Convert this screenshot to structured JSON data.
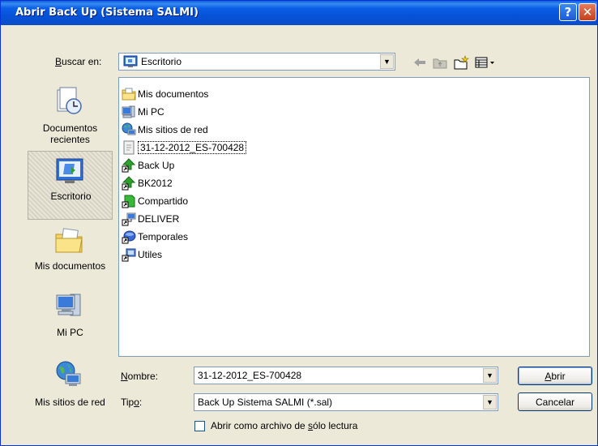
{
  "window": {
    "title": "Abrir Back Up (Sistema SALMI)",
    "help_glyph": "?",
    "close_glyph": "✕"
  },
  "lookin": {
    "label_pre": "B",
    "label_post": "uscar en:",
    "value": "Escritorio"
  },
  "places": [
    {
      "label": "Documentos recientes",
      "icon": "recent-documents-icon"
    },
    {
      "label": "Escritorio",
      "icon": "desktop-icon"
    },
    {
      "label": "Mis documentos",
      "icon": "my-documents-icon"
    },
    {
      "label": "Mi PC",
      "icon": "my-computer-icon"
    },
    {
      "label": "Mis sitios de red",
      "icon": "network-places-icon"
    }
  ],
  "files": [
    {
      "name": "Mis documentos",
      "icon": "folder-documents-icon"
    },
    {
      "name": "Mi PC",
      "icon": "computer-icon"
    },
    {
      "name": "Mis sitios de red",
      "icon": "network-icon"
    },
    {
      "name": "31-12-2012_ES-700428",
      "icon": "file-icon",
      "selected": true
    },
    {
      "name": "Back Up",
      "icon": "shortcut-app-icon"
    },
    {
      "name": "BK2012",
      "icon": "shortcut-app-icon"
    },
    {
      "name": "Compartido",
      "icon": "shortcut-green-icon"
    },
    {
      "name": "DELIVER",
      "icon": "shortcut-network-icon"
    },
    {
      "name": "Temporales",
      "icon": "shortcut-drive-icon"
    },
    {
      "name": "Utiles",
      "icon": "shortcut-blue-icon"
    }
  ],
  "filename": {
    "label_pre": "N",
    "label_post": "ombre:",
    "value": "31-12-2012_ES-700428"
  },
  "filetype": {
    "label_pre": "Tip",
    "label_u": "o",
    "label_post": ":",
    "value": "Back Up Sistema SALMI (*.sal)"
  },
  "buttons": {
    "open_pre": "",
    "open_u": "A",
    "open_post": "brir",
    "cancel": "Cancelar"
  },
  "readonly": {
    "label_pre": "Abrir como archivo de ",
    "label_u": "s",
    "label_post": "ólo lectura",
    "checked": false
  }
}
